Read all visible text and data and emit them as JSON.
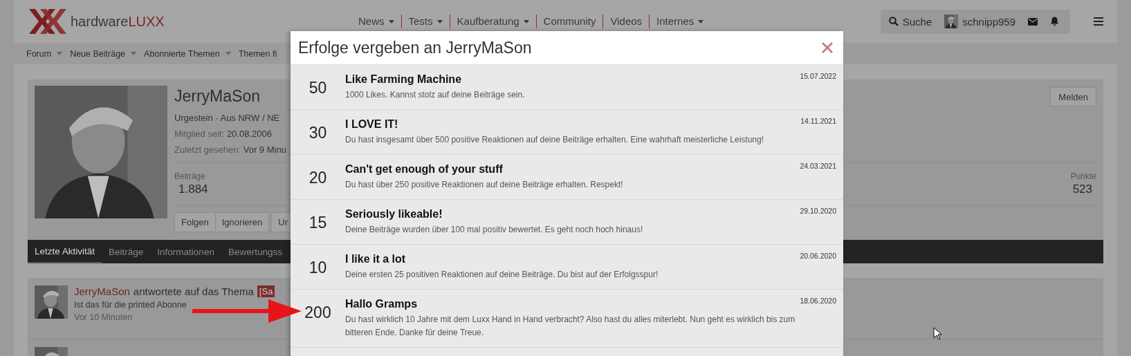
{
  "header": {
    "logo_text": "hardware",
    "logo_accent": "LUXX",
    "nav": [
      {
        "label": "News",
        "dropdown": true
      },
      {
        "label": "Tests",
        "dropdown": true
      },
      {
        "label": "Kaufberatung",
        "dropdown": true
      },
      {
        "label": "Community",
        "dropdown": false
      },
      {
        "label": "Videos",
        "dropdown": false
      },
      {
        "label": "Internes",
        "dropdown": true
      }
    ],
    "search_label": "Suche",
    "username": "schnipp959"
  },
  "subnav": [
    {
      "label": "Forum",
      "dropdown": true
    },
    {
      "label": "Neue Beiträge",
      "dropdown": true
    },
    {
      "label": "Abonnierte Themen",
      "dropdown": true
    },
    {
      "label": "Themen fi",
      "dropdown": false
    }
  ],
  "profile": {
    "name": "JerryMaSon",
    "subtitle": "Urgestein · Aus NRW / NE",
    "joined_label": "Mitglied seit:",
    "joined": "20.08.2006",
    "seen_label": "Zuletzt gesehen:",
    "seen": "Vor 9 Minu",
    "report_button": "Melden",
    "stats": [
      {
        "label": "Beiträge",
        "value": "1.884"
      },
      {
        "label": "Punkte",
        "value": "523"
      }
    ],
    "buttons": [
      "Folgen",
      "Ignorieren",
      "Ur"
    ]
  },
  "tabs": [
    {
      "label": "Letzte Aktivität",
      "selected": true
    },
    {
      "label": "Beiträge",
      "selected": false
    },
    {
      "label": "Informationen",
      "selected": false
    },
    {
      "label": "Bewertungss",
      "selected": false
    }
  ],
  "activity": [
    {
      "user": "JerryMaSon",
      "action": "antwortete auf das Thema",
      "tag": "[Sa",
      "snippet": "Ist das für die printed Abonne",
      "time": "Vor 10 Minuten"
    }
  ],
  "modal": {
    "title": "Erfolge vergeben an JerryMaSon",
    "items": [
      {
        "points": "50",
        "title": "Like Farming Machine",
        "description": "1000 Likes. Kannst stolz auf deine Beiträge sein.",
        "date": "15.07.2022"
      },
      {
        "points": "30",
        "title": "I LOVE IT!",
        "description": "Du hast insgesamt über 500 positive Reaktionen auf deine Beiträge erhalten. Eine wahrhaft meisterliche Leistung!",
        "date": "14.11.2021"
      },
      {
        "points": "20",
        "title": "Can't get enough of your stuff",
        "description": "Du hast über 250 positive Reaktionen auf deine Beiträge erhalten. Respekt!",
        "date": "24.03.2021"
      },
      {
        "points": "15",
        "title": "Seriously likeable!",
        "description": "Deine Beiträge wurden über 100 mal positiv bewertet. Es geht noch hoch hinaus!",
        "date": "29.10.2020"
      },
      {
        "points": "10",
        "title": "I like it a lot",
        "description": "Deine ersten 25 positiven Reaktionen auf deine Beiträge. Du bist auf der Erfolgsspur!",
        "date": "20.06.2020"
      },
      {
        "points": "200",
        "title": "Hallo Gramps",
        "description": "Du hast wirklich 10 Jahre mit dem Luxx Hand in Hand verbracht? Also hast du alles miterlebt. Nun geht es wirklich bis zum bitteren Ende. Danke für deine Treue.",
        "date": "18.06.2020"
      }
    ]
  }
}
